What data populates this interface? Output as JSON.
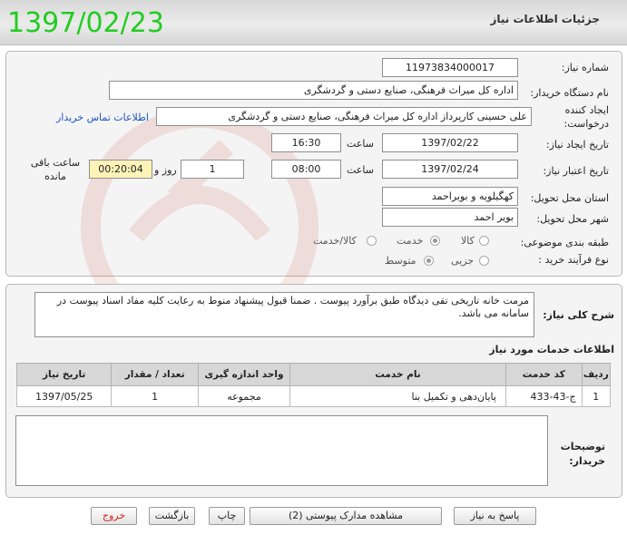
{
  "header": {
    "title": "جزئیات اطلاعات نیاز",
    "date_overlay": "1397/02/23"
  },
  "form": {
    "need_number": {
      "label": "شماره نیاز:",
      "value": "1197383400001​7"
    },
    "buyer_org": {
      "label": "نام دستگاه خریدار:",
      "value": "اداره کل میراث فرهنگی، صنایع دستی و گردشگری"
    },
    "requester": {
      "label_line1": "ایجاد کننده",
      "label_line2": "درخواست:",
      "value": "علی حسینی کارپرداز اداره کل میراث فرهنگی، صنایع دستی و گردشگری",
      "contact_link": "اطلاعات تماس خریدار"
    },
    "created": {
      "label": "تاریخ ایجاد نیاز:",
      "date": "1397/02/22",
      "time_label": "ساعت",
      "time": "16:30"
    },
    "validity": {
      "label": "تاریخ اعتبار نیاز:",
      "date": "1397/02/24",
      "time_label": "ساعت",
      "time": "08:00",
      "days": "1",
      "days_label": "روز و",
      "remaining": "00:20:04",
      "remaining_label_line1": "ساعت باقی",
      "remaining_label_line2": "مانده"
    },
    "province": {
      "label": "استان محل تحویل:",
      "value": "کهگیلویه و بویراحمد"
    },
    "city": {
      "label": "شهر محل تحویل:",
      "value": "بویر احمد"
    },
    "category": {
      "label": "طبقه بندی موضوعی:",
      "options": [
        "کالا",
        "خدمت",
        "کالا/خدمت"
      ],
      "selected": "خدمت"
    },
    "process": {
      "label": "نوع فرآیند خرید :",
      "options": [
        "جزیی",
        "متوسط"
      ],
      "selected": "متوسط"
    }
  },
  "description": {
    "label": "شرح کلی نیاز:",
    "text": "مرمت خانه تاریخی تقی دیدگاه طبق برآورد پیوست . ضمنا قبول پیشنهاد منوط به رعایت کلیه مفاد اسناد پیوست در سامانه می باشد."
  },
  "services": {
    "title": "اطلاعات خدمات مورد نیاز",
    "headers": [
      "ردیف",
      "کد خدمت",
      "نام خدمت",
      "واحد اندازه گیری",
      "تعداد / مقدار",
      "تاریخ نیاز"
    ],
    "rows": [
      [
        "1",
        "ج-43-433",
        "پایان‌دهی و تکمیل بنا",
        "مجموعه",
        "1",
        "1397/05/25"
      ]
    ]
  },
  "buyer_notes": {
    "label_line1": "توضیحات",
    "label_line2": "خریدار:",
    "value": ""
  },
  "buttons": {
    "reply": "پاسخ به نیاز",
    "attachments": "مشاهده مدارک پیوستی (2)",
    "print": "چاپ",
    "back": "بازگشت",
    "exit": "خروج"
  },
  "colors": {
    "date_overlay": "#22cc22",
    "link": "#1a55c4",
    "remaining_bg": "#fff3b8",
    "exit_text": "#cc2222"
  }
}
